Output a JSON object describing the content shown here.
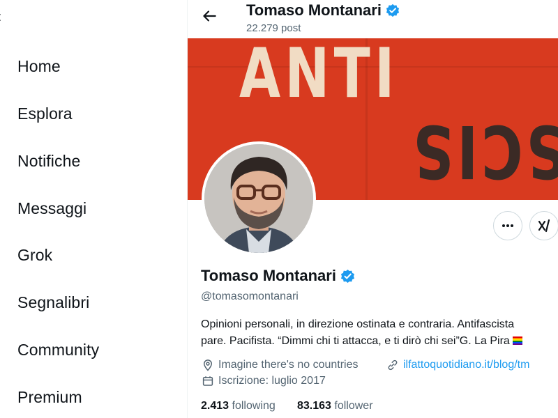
{
  "nav": {
    "items": [
      {
        "label": "Home",
        "icon": "home-icon"
      },
      {
        "label": "Esplora",
        "icon": "search-icon"
      },
      {
        "label": "Notifiche",
        "icon": "bell-icon"
      },
      {
        "label": "Messaggi",
        "icon": "mail-icon"
      },
      {
        "label": "Grok",
        "icon": "grok-icon"
      },
      {
        "label": "Segnalibri",
        "icon": "bookmark-icon"
      },
      {
        "label": "Community",
        "icon": "community-icon"
      },
      {
        "label": "Premium",
        "icon": "premium-icon"
      }
    ]
  },
  "header": {
    "name": "Tomaso Montanari",
    "posts": "22.279 post"
  },
  "banner": {
    "top_text": "ANTI",
    "bottom_text": "FASCIS"
  },
  "profile": {
    "name": "Tomaso Montanari",
    "handle": "@tomasomontanari",
    "bio_line1": "Opinioni personali, in direzione ostinata e contraria. Antifascista",
    "bio_line2": "pare. Pacifista. “Dimmi chi ti attacca, e ti dirò chi sei”G. La Pira",
    "location": "Imagine there's no countries",
    "website": "ilfattoquotidiano.it/blog/tm",
    "joined": "Iscrizione: luglio 2017",
    "following_count": "2.413",
    "following_label": "following",
    "followers_count": "83.163",
    "followers_label": "follower"
  },
  "colors": {
    "accent": "#1d9bf0",
    "verified": "#1d9bf0",
    "banner_red": "#d83a1f",
    "muted_text": "#536471"
  }
}
